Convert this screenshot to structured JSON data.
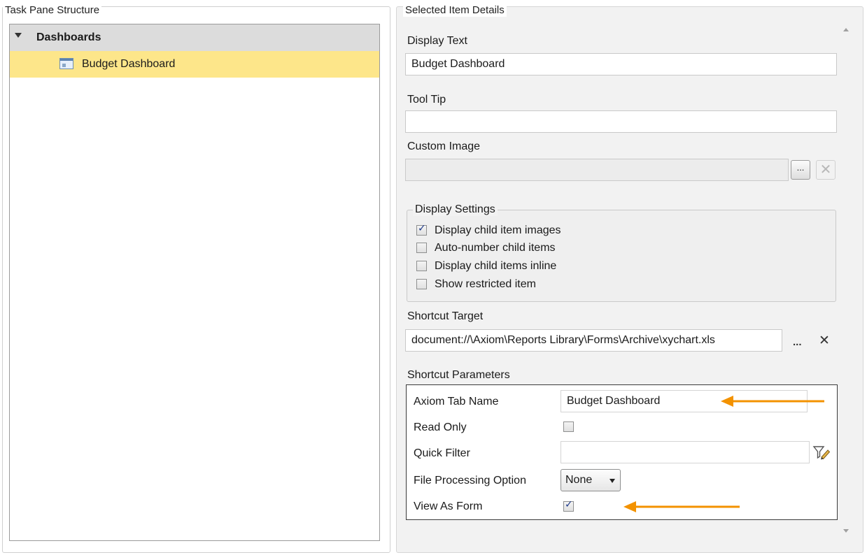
{
  "left_panel": {
    "title": "Task Pane Structure",
    "tree": [
      {
        "label": "Dashboards",
        "expanded": true
      },
      {
        "label": "Budget Dashboard",
        "selected": true,
        "icon": "dashboard-icon"
      }
    ]
  },
  "right_panel": {
    "title": "Selected Item Details",
    "display_text": {
      "label": "Display Text",
      "value": "Budget Dashboard"
    },
    "tool_tip": {
      "label": "Tool Tip",
      "value": ""
    },
    "custom_image": {
      "label": "Custom Image",
      "value": "",
      "browse_label": "...",
      "clear_label": "✕"
    },
    "display_settings": {
      "title": "Display Settings",
      "options": [
        {
          "label": "Display child item images",
          "checked": true
        },
        {
          "label": "Auto-number child items",
          "checked": false
        },
        {
          "label": "Display child items inline",
          "checked": false
        },
        {
          "label": "Show restricted item",
          "checked": false
        }
      ]
    },
    "shortcut_target": {
      "label": "Shortcut Target",
      "value": "document://\\Axiom\\Reports Library\\Forms\\Archive\\xychart.xls",
      "browse_label": "...",
      "clear_label": "✕"
    },
    "shortcut_parameters": {
      "label": "Shortcut Parameters",
      "rows": [
        {
          "name": "Axiom Tab Name",
          "value": "Budget Dashboard"
        },
        {
          "name": "Read Only",
          "checked": false
        },
        {
          "name": "Quick Filter",
          "value": ""
        },
        {
          "name": "File Processing Option",
          "selected": "None"
        },
        {
          "name": "View As Form",
          "checked": true
        }
      ]
    }
  },
  "colors": {
    "selection": "#fde68a",
    "tree_header": "#dcdcdc",
    "annotation_arrow": "#f39200",
    "checkmark": "#1f3a8a"
  }
}
